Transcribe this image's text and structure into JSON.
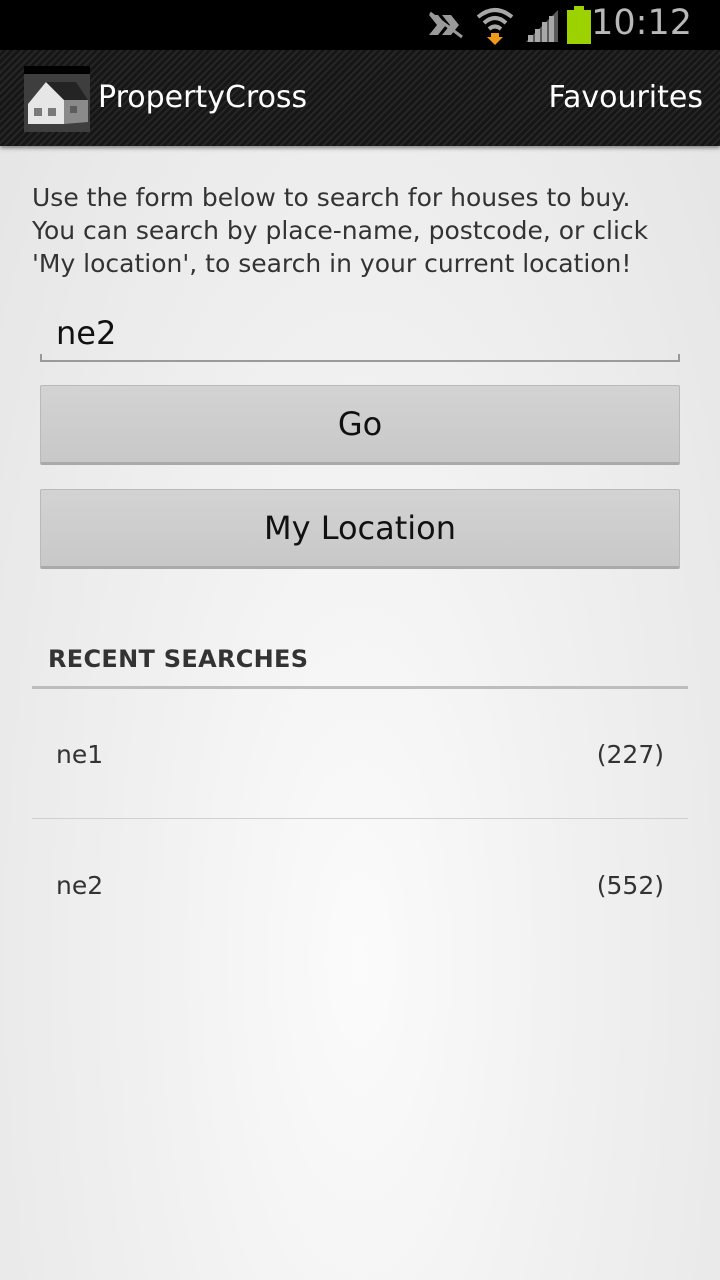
{
  "status_bar": {
    "time": "10:12",
    "icons": [
      "nfc-icon",
      "wifi-icon",
      "signal-icon",
      "battery-icon"
    ],
    "battery_color": "#9bd200"
  },
  "action_bar": {
    "app_name": "PropertyCross",
    "app_icon": "house-icon",
    "favourites_label": "Favourites"
  },
  "search": {
    "intro_lines": [
      "Use the form below to search for houses to buy.",
      "You can search by place-name, postcode, or click",
      "'My location', to search in your current location!"
    ],
    "query_value": "ne2",
    "go_label": "Go",
    "my_location_label": "My Location"
  },
  "recent": {
    "header": "RECENT SEARCHES",
    "items": [
      {
        "place": "ne1",
        "count": "(227)"
      },
      {
        "place": "ne2",
        "count": "(552)"
      }
    ]
  }
}
